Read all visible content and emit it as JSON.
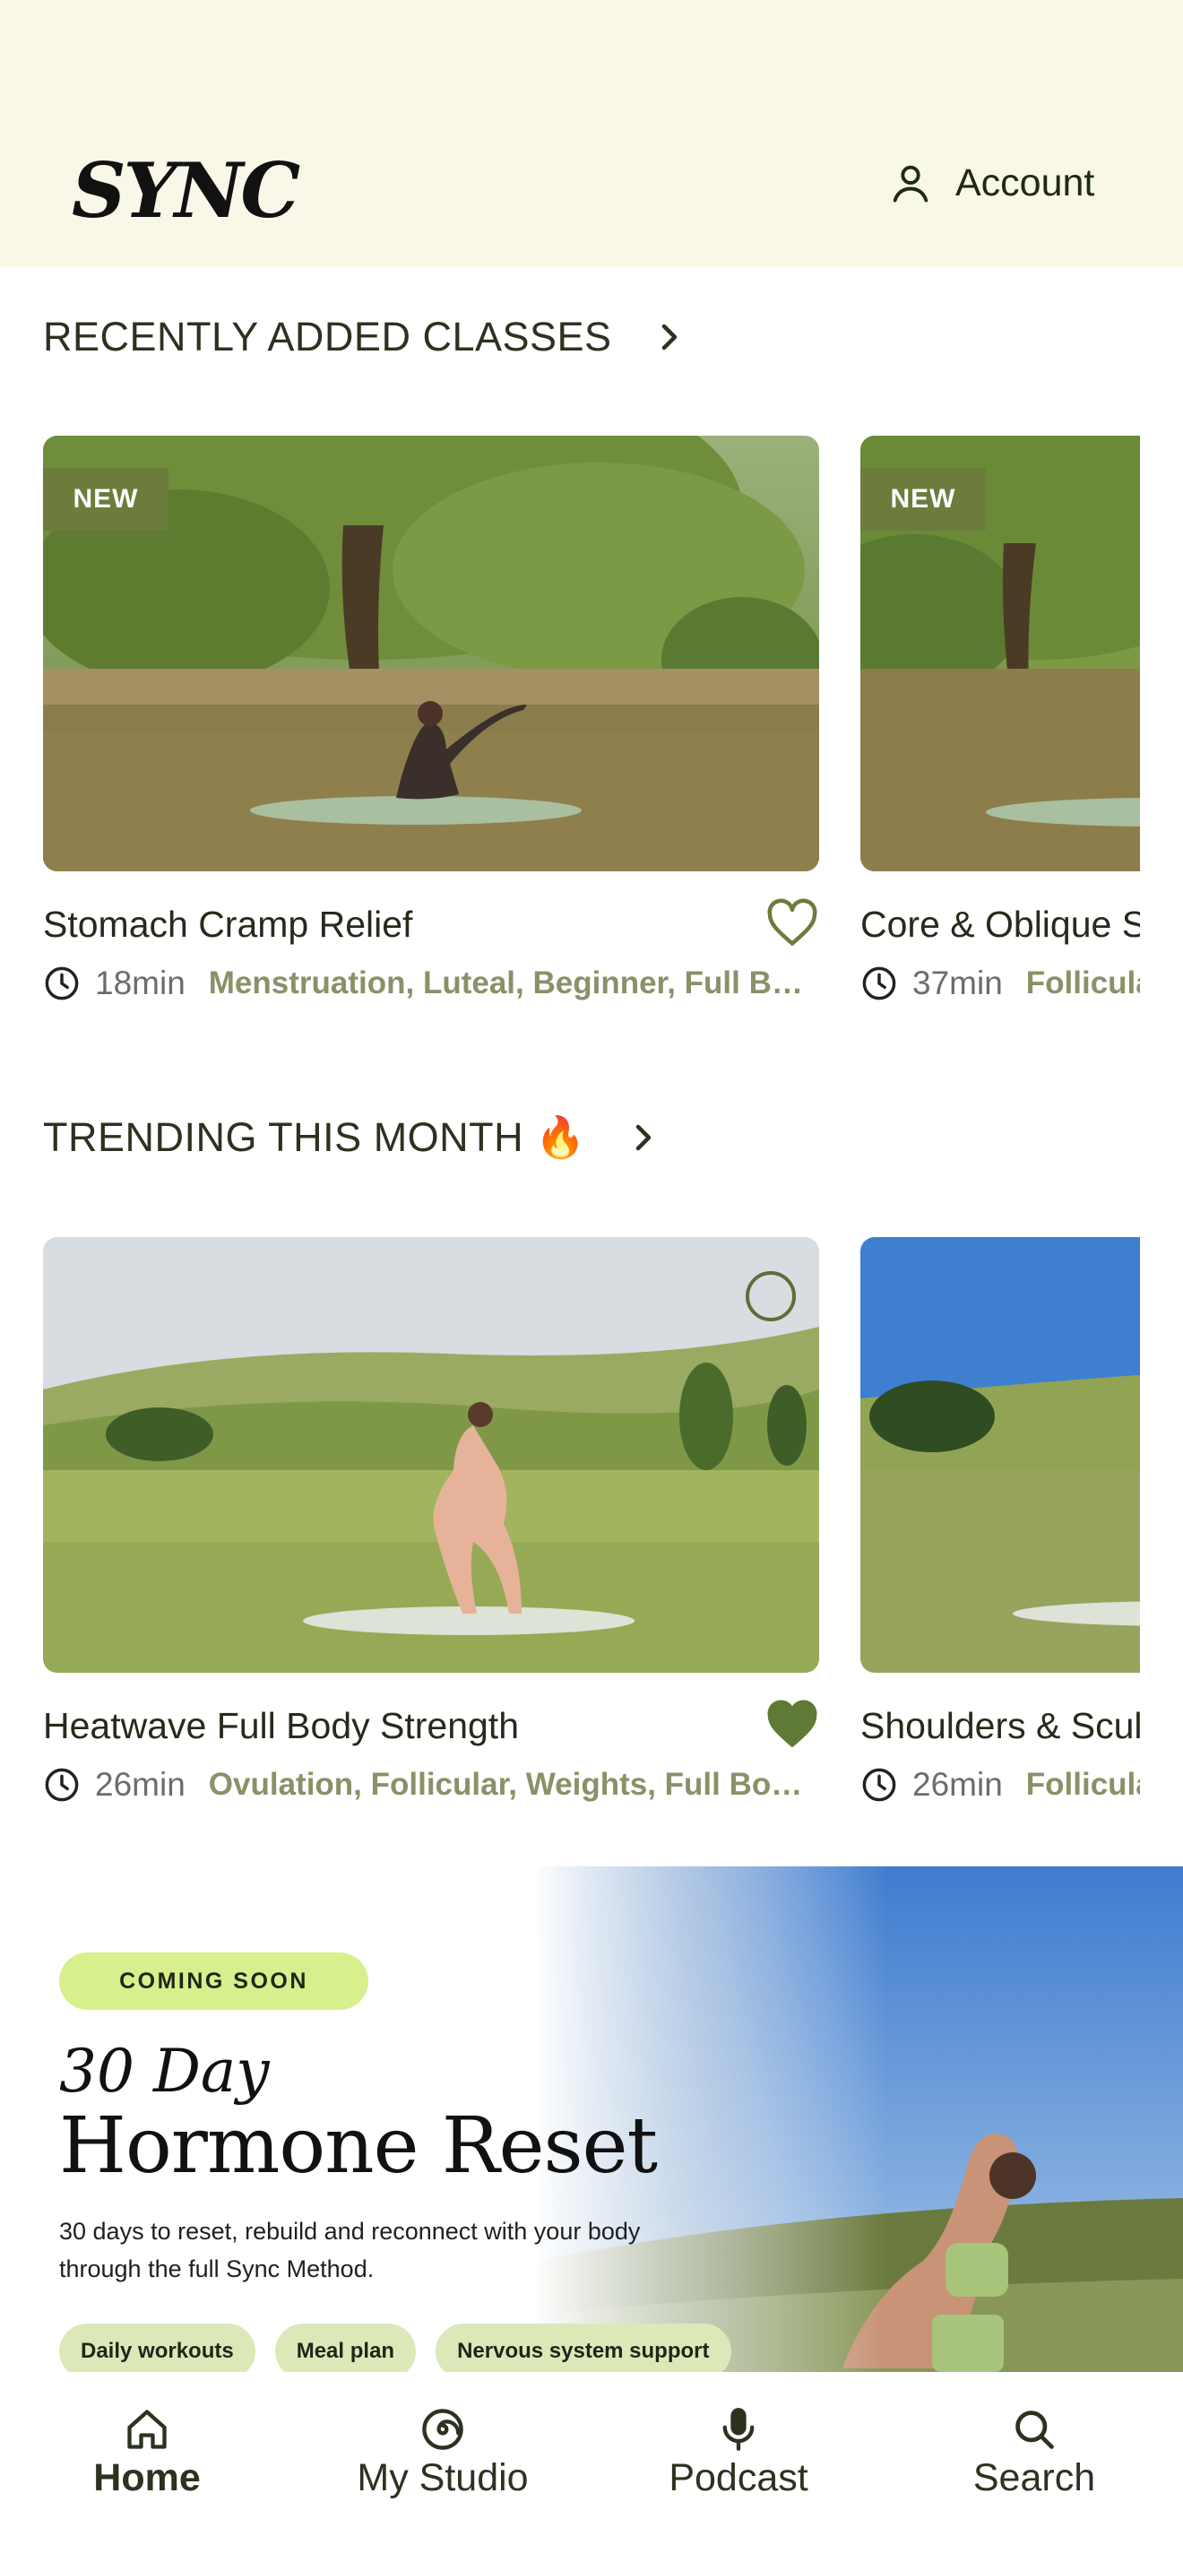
{
  "header": {
    "logo": "SYNC",
    "account_label": "Account"
  },
  "sections": {
    "recent": {
      "title": "RECENTLY ADDED CLASSES"
    },
    "trending": {
      "title": "TRENDING THIS MONTH 🔥"
    }
  },
  "recent_cards": [
    {
      "badge": "NEW",
      "title": "Stomach Cramp Relief",
      "duration": "18min",
      "tags": "Menstruation, Luteal, Beginner, Full Bod…",
      "favorited": false
    },
    {
      "badge": "NEW",
      "title": "Core & Oblique S",
      "duration": "37min",
      "tags": "Follicula",
      "favorited": false
    }
  ],
  "trending_cards": [
    {
      "title": "Heatwave Full Body Strength",
      "duration": "26min",
      "tags": "Ovulation, Follicular, Weights, Full Body, …",
      "favorited": true
    },
    {
      "title": "Shoulders & Scul",
      "duration": "26min",
      "tags": "Follicula",
      "favorited": false
    }
  ],
  "promo": {
    "badge": "COMING SOON",
    "subtitle": "30 Day",
    "title": "Hormone Reset",
    "description": "30 days to reset, rebuild and reconnect with your body through the full Sync Method.",
    "pills": [
      "Daily workouts",
      "Meal plan",
      "Nervous system support"
    ]
  },
  "tabbar": {
    "items": [
      {
        "label": "Home",
        "icon": "home-icon",
        "active": true
      },
      {
        "label": "My Studio",
        "icon": "spiral-icon",
        "active": false
      },
      {
        "label": "Podcast",
        "icon": "microphone-icon",
        "active": false
      },
      {
        "label": "Search",
        "icon": "search-icon",
        "active": false
      }
    ]
  },
  "colors": {
    "header_bg": "#f9f7e8",
    "accent_green": "#6b7c3d",
    "tag_text": "#8a9168",
    "coming_soon_bg": "#d7ef8c",
    "pill_bg": "#dde8b9"
  }
}
